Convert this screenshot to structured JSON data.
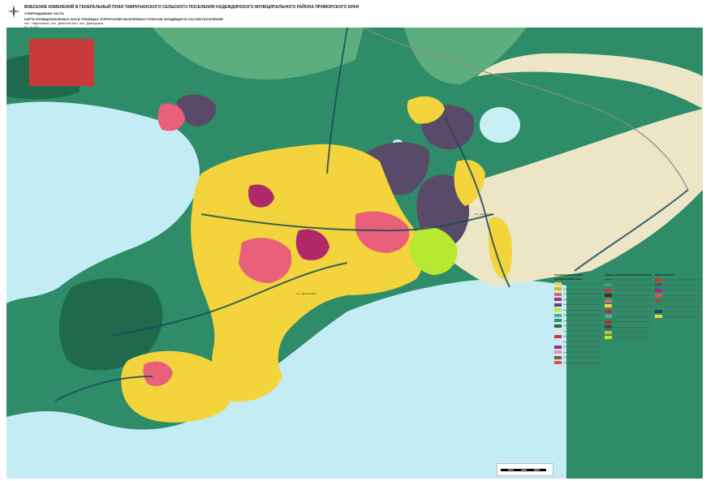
{
  "title": {
    "line1": "ВНЕСЕНИЕ ИЗМЕНЕНИЙ В ГЕНЕРАЛЬНЫЙ ПЛАН ТАВРИЧАНСКОГО СЕЛЬСКОГО ПОСЕЛЕНИЯ НАДЕЖДИНСКОГО МУНИЦИПАЛЬНОГО РАЙОНА ПРИМОРСКОГО КРАЯ",
    "line2": "УТВЕРЖДАЕМАЯ ЧАСТЬ",
    "line3": "КАРТА ФУНКЦИОНАЛЬНЫХ ЗОН В ГРАНИЦАХ ТЕРРИТОРИЙ НАСЕЛЕННЫХ ПУНКТОВ, ВХОДЯЩИХ В СОСТАВ ПОСЕЛЕНИЯ",
    "line4": "пос. Тавричанка, пос. Девятый Вал, пос. Давыдовка",
    "line5": "М 1:5 000"
  },
  "map_labels": {
    "davydovka": "пос. Давыдовка",
    "devyaty_val": "пос. Девятый Вал"
  },
  "legend": {
    "sections": [
      "УСЛОВНЫЕ ОБОЗНАЧЕНИЯ",
      "ФУНКЦИОНАЛЬНЫЕ ЗОНЫ",
      "ОБЪЕКТЫ ТРАНСПОРТНОЙ ИНФРАСТРУКТУРЫ",
      "ПРОЧИЕ ОБЪЕКТЫ"
    ]
  },
  "colors": {
    "sea": "#c4ecf4",
    "forest": "#2f8c68",
    "forest_dark": "#1f6a4d",
    "green_light": "#5cae7f",
    "residential": "#f3d43c",
    "residential_dark": "#d9b81e",
    "commercial": "#e8607a",
    "public": "#b02a6a",
    "industrial": "#5a4a6a",
    "agri": "#ece6c6",
    "recreation": "#b8e830",
    "lake": "#c8eef6",
    "roads": "#1d4a5a",
    "red_zone": "#c83a3a"
  },
  "icons": {
    "compass": "north-arrow-icon"
  }
}
